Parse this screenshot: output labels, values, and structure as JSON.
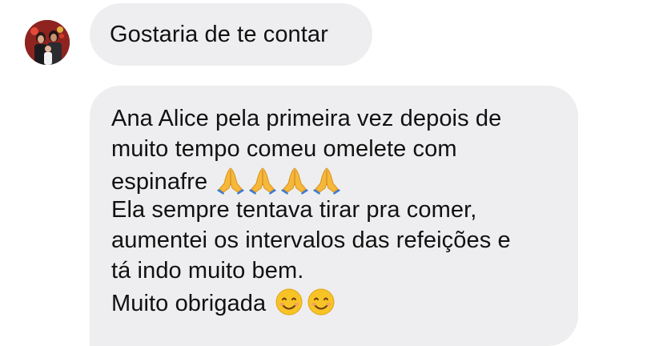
{
  "messages": [
    {
      "text": "Gostaria de te contar"
    },
    {
      "lines": [
        "Ana Alice pela primeira vez depois de",
        "muito tempo comeu omelete com",
        "espinafre",
        "Ela sempre tentava tirar pra comer,",
        "aumentei os intervalos das refeições e",
        "tá indo muito bem.",
        "Muito obrigada"
      ],
      "emojis": {
        "after_line_3": [
          "praying-hands",
          "praying-hands",
          "praying-hands",
          "praying-hands"
        ],
        "after_line_7": [
          "smiling-face",
          "smiling-face"
        ]
      }
    }
  ],
  "colors": {
    "bubble_bg": "#eeeef0",
    "text": "#111111",
    "avatar_bg": "#c23a2e"
  }
}
